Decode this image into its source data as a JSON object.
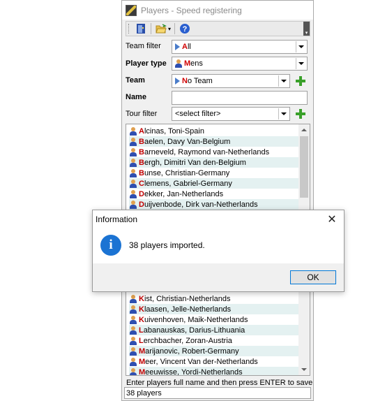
{
  "window": {
    "title": "Players - Speed registering"
  },
  "toolbar": {
    "buttons": [
      {
        "icon": "exit-door-icon"
      },
      {
        "icon": "open-folder-icon"
      },
      {
        "icon": "help-icon"
      }
    ]
  },
  "form": {
    "team_filter": {
      "label": "Team filter",
      "value_initial": "A",
      "value_rest": "ll"
    },
    "player_type": {
      "label": "Player type",
      "value_initial": "M",
      "value_rest": "ens"
    },
    "team": {
      "label": "Team",
      "value_initial": "N",
      "value_rest": "o Team"
    },
    "name": {
      "label": "Name",
      "value": ""
    },
    "tour_filter": {
      "label": "Tour filter",
      "value": "<select filter>"
    }
  },
  "players_top": [
    {
      "initial": "A",
      "rest": "lcinas, Toni-Spain"
    },
    {
      "initial": "B",
      "rest": "aelen, Davy Van-Belgium"
    },
    {
      "initial": "B",
      "rest": "arneveld, Raymond van-Netherlands"
    },
    {
      "initial": "B",
      "rest": "ergh, Dimitri Van den-Belgium"
    },
    {
      "initial": "B",
      "rest": "unse, Christian-Germany"
    },
    {
      "initial": "C",
      "rest": "lemens, Gabriel-Germany"
    },
    {
      "initial": "D",
      "rest": "ekker, Jan-Netherlands"
    },
    {
      "initial": "D",
      "rest": "uijvenbode, Dirk van-Netherlands"
    }
  ],
  "players_bottom": [
    {
      "initial": "K",
      "rest": "ist, Christian-Netherlands"
    },
    {
      "initial": "K",
      "rest": "laasen, Jelle-Netherlands"
    },
    {
      "initial": "K",
      "rest": "uivenhoven, Maik-Netherlands"
    },
    {
      "initial": "L",
      "rest": "abanauskas, Darius-Lithuania"
    },
    {
      "initial": "L",
      "rest": "erchbacher, Zoran-Austria"
    },
    {
      "initial": "M",
      "rest": "arijanovic, Robert-Germany"
    },
    {
      "initial": "M",
      "rest": "eer, Vincent Van der-Netherlands"
    },
    {
      "initial": "M",
      "rest": "eeuwisse, Yordi-Netherlands"
    }
  ],
  "hint": "Enter players full name and then press ENTER to save",
  "status": "38 players",
  "dialog": {
    "title": "Information",
    "message": "38 players imported.",
    "ok_label": "OK",
    "close_glyph": "✕",
    "info_glyph": "i"
  }
}
